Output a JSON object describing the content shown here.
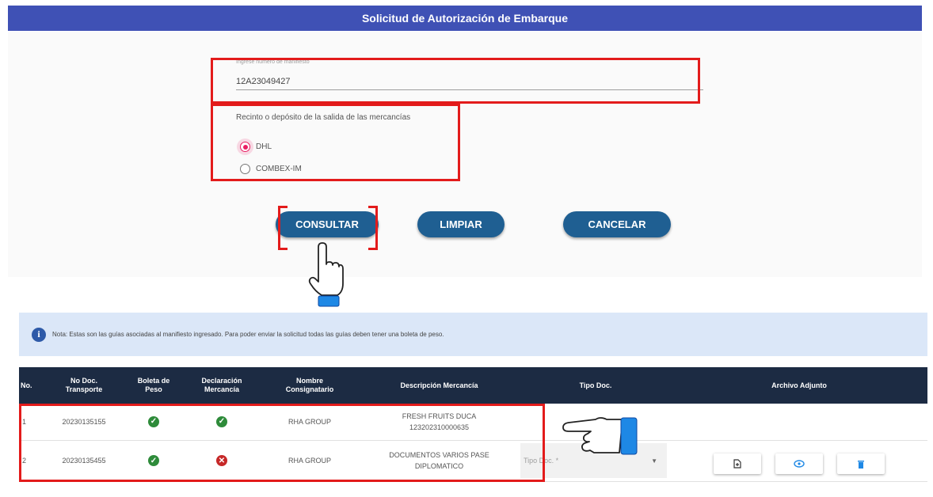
{
  "header": {
    "title": "Solicitud de Autorización de Embarque"
  },
  "manifest": {
    "label": "Ingrese número de manifiesto",
    "value": "12A23049427"
  },
  "deposit": {
    "label": "Recinto o depósito de la salida de las mercancías",
    "options": [
      {
        "label": "DHL",
        "selected": true
      },
      {
        "label": "COMBEX-IM",
        "selected": false
      }
    ]
  },
  "actions": {
    "consult": "CONSULTAR",
    "clear": "LIMPIAR",
    "cancel": "CANCELAR"
  },
  "note": {
    "icon": "info-icon",
    "text": "Nota: Estas son las guías asociadas al manifiesto ingresado. Para poder enviar la solicitud todas las guías deben tener una boleta de peso."
  },
  "table": {
    "headers": {
      "no": "No.",
      "doc": [
        "No Doc.",
        "Transporte"
      ],
      "boleta": [
        "Boleta de",
        "Peso"
      ],
      "decl": [
        "Declaración",
        "Mercancía"
      ],
      "consig": [
        "Nombre",
        "Consignatario"
      ],
      "desc": "Descripción Mercancía",
      "tipo": "Tipo Doc.",
      "adjunto": "Archivo Adjunto"
    },
    "rows": [
      {
        "no": "1",
        "doc": "20230135155",
        "boleta": "ok",
        "decl": "ok",
        "consig": "RHA GROUP",
        "desc": [
          "FRESH FRUITS DUCA",
          "123202310000635"
        ]
      },
      {
        "no": "2",
        "doc": "20230135455",
        "boleta": "ok",
        "decl": "error",
        "consig": "RHA GROUP",
        "desc": [
          "DOCUMENTOS VARIOS PASE",
          "DIPLOMATICO"
        ]
      }
    ]
  },
  "tipo_doc_select": {
    "placeholder": "Tipo Doc. *"
  },
  "attachments": {
    "icons": [
      "file-add-icon",
      "eye-icon",
      "trash-icon"
    ]
  },
  "colors": {
    "header": "#3f51b5",
    "button": "#1f5f92",
    "table_header": "#1c2b43",
    "highlight": "#e31b1b",
    "ok": "#2e8b3a",
    "error": "#c62828"
  }
}
